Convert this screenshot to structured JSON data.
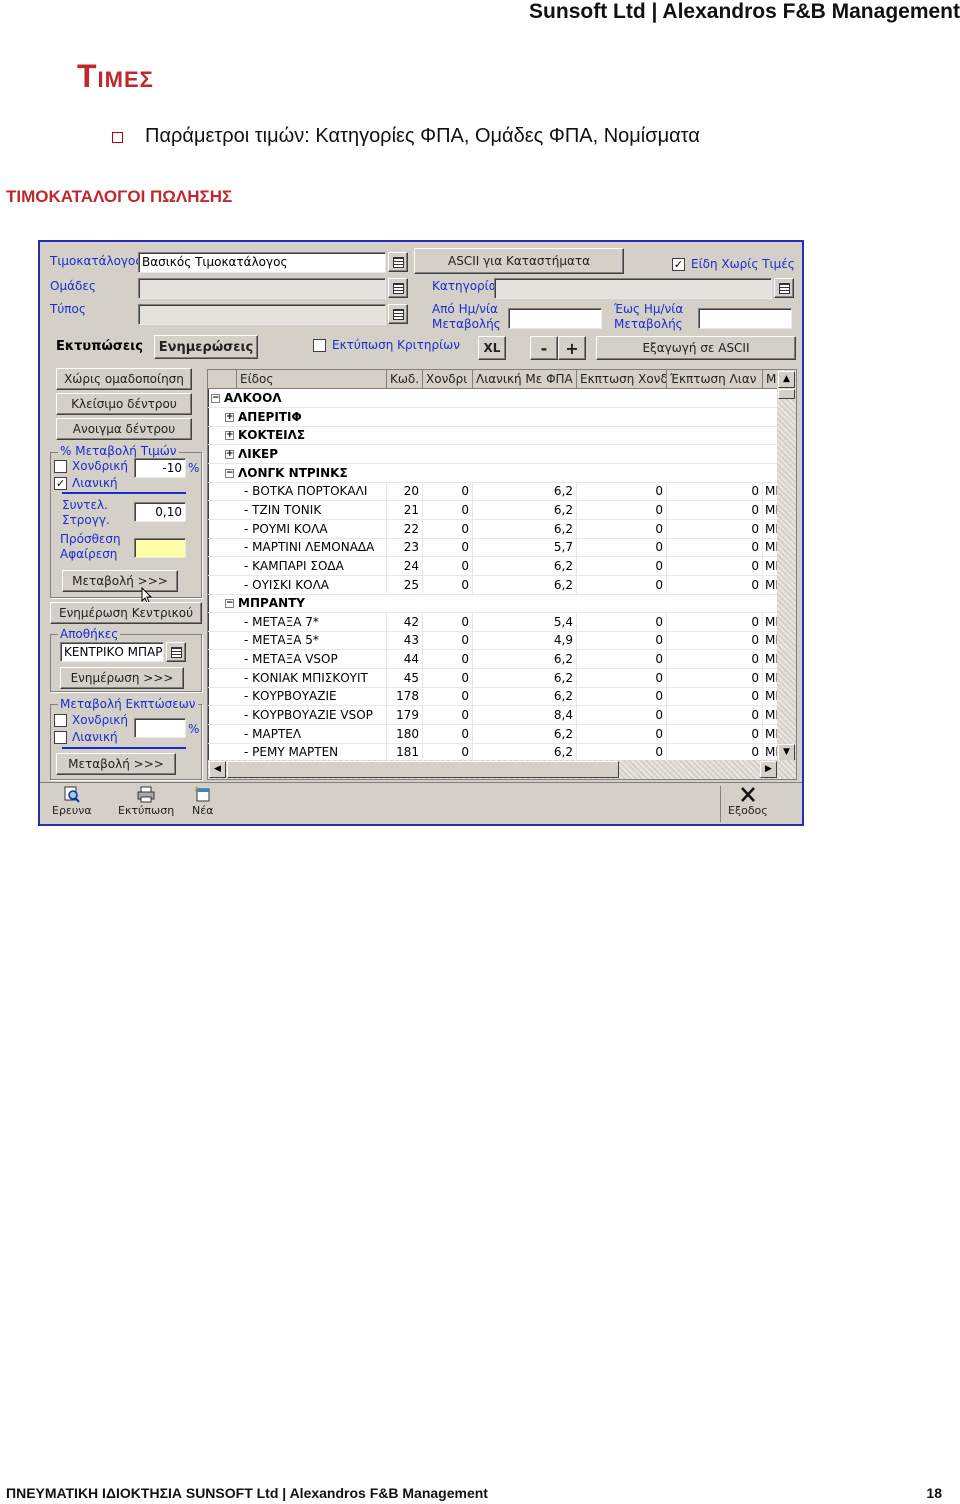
{
  "header": "Sunsoft Ltd  |  Alexandros F&B Management",
  "title": "Τιμες",
  "bullet": "Παράμετροι τιμών: Κατηγορίες ΦΠΑ, Ομάδες ΦΠΑ, Νομίσματα",
  "subheading": "ΤΙΜΟΚΑΤΑΛΟΓΟΙ ΠΩΛΗΣΗΣ",
  "app": {
    "pricelist_label": "Τιμοκατάλογος",
    "pricelist_value": "Βασικός Τιμοκατάλογος",
    "groups_label": "Ομάδες",
    "type_label": "Τύπος",
    "ascii_button": "ASCII για Καταστήματα",
    "no_price_items_label": "Είδη Χωρίς Τιμές",
    "category_label": "Κατηγορία",
    "from_date_label": "Από Ημ/νία Μεταβολής",
    "to_date_label": "Έως Ημ/νία Μεταβολής",
    "tab_prints": "Εκτυπώσεις",
    "tab_updates": "Ενημερώσεις",
    "print_criteria_label": "Εκτύπωση Κριτηρίων",
    "xl_button": "XL",
    "minus_button": "-",
    "plus_button": "+",
    "export_ascii_button": "Εξαγωγή σε ASCII",
    "side": {
      "no_grouping": "Χώρις ομαδοποίηση",
      "close_tree": "Κλείσιμο δέντρου",
      "open_tree": "Ανοιγμα δέντρου",
      "price_change_group": "% Μεταβολή Τιμών",
      "wholesale": "Χονδρική",
      "retail": "Λιανική",
      "percent_value": "-10",
      "percent_sign": "%",
      "rounding_label": "Συντελ. Στρογγ.",
      "rounding_value": "0,10",
      "add_remove_label": "Πρόσθεση Αφαίρεση",
      "change_button": "Μεταβολή >>>",
      "update_central": "Ενημέρωση Κεντρικού",
      "stores_group": "Αποθήκες",
      "store_value": "ΚΕΝΤΡΙΚΟ ΜΠΑΡ",
      "update_button": "Ενημέρωση >>>",
      "discount_change_group": "Μεταβολή Εκπτώσεων",
      "wholesale2": "Χονδρική",
      "retail2": "Λιανική",
      "percent_sign2": "%",
      "change_button2": "Μεταβολή >>>"
    },
    "grid": {
      "columns": [
        "Είδος",
        "Κωδ.",
        "Χονδρι",
        "Λιανική Με ΦΠΑ",
        "Εκπτωση Χονδ",
        "Έκπτωση Λιαν",
        "Μο"
      ],
      "rows": [
        {
          "kind": "group",
          "toggle": "−",
          "indent": 0,
          "name": "ΑΛΚΟΟΛ"
        },
        {
          "kind": "group",
          "toggle": "+",
          "indent": 1,
          "name": "ΑΠΕΡΙΤΙΦ"
        },
        {
          "kind": "group",
          "toggle": "+",
          "indent": 1,
          "name": "ΚΟΚΤΕΙΛΣ"
        },
        {
          "kind": "group",
          "toggle": "+",
          "indent": 1,
          "name": "ΛΙΚΕΡ"
        },
        {
          "kind": "group",
          "toggle": "−",
          "indent": 1,
          "name": "ΛΟΝΓΚ ΝΤΡΙΝΚΣ"
        },
        {
          "kind": "item",
          "name": "- ΒΟΤΚΑ ΠΟΡΤΟΚΑΛΙ",
          "code": "20",
          "wh": "0",
          "ret": "6,2",
          "dw": "0",
          "dr": "0",
          "m": "ΜΕ"
        },
        {
          "kind": "item",
          "name": "- ΤΖΙΝ ΤΟΝΙΚ",
          "code": "21",
          "wh": "0",
          "ret": "6,2",
          "dw": "0",
          "dr": "0",
          "m": "ΜΕ"
        },
        {
          "kind": "item",
          "name": "- ΡΟΥΜΙ ΚΟΛΑ",
          "code": "22",
          "wh": "0",
          "ret": "6,2",
          "dw": "0",
          "dr": "0",
          "m": "ΜΕ"
        },
        {
          "kind": "item",
          "name": "- ΜΑΡΤΙΝΙ ΛΕΜΟΝΑΔΑ",
          "code": "23",
          "wh": "0",
          "ret": "5,7",
          "dw": "0",
          "dr": "0",
          "m": "ΜΕ"
        },
        {
          "kind": "item",
          "name": "- ΚΑΜΠΑΡΙ ΣΟΔΑ",
          "code": "24",
          "wh": "0",
          "ret": "6,2",
          "dw": "0",
          "dr": "0",
          "m": "ΜΕ"
        },
        {
          "kind": "item",
          "name": "- ΟΥΙΣΚΙ ΚΟΛΑ",
          "code": "25",
          "wh": "0",
          "ret": "6,2",
          "dw": "0",
          "dr": "0",
          "m": "ΜΕ"
        },
        {
          "kind": "group",
          "toggle": "−",
          "indent": 1,
          "name": "ΜΠΡΑΝΤΥ"
        },
        {
          "kind": "item",
          "name": "- ΜΕΤΑΞΑ 7*",
          "code": "42",
          "wh": "0",
          "ret": "5,4",
          "dw": "0",
          "dr": "0",
          "m": "ΜΕ"
        },
        {
          "kind": "item",
          "name": "- ΜΕΤΑΞΑ 5*",
          "code": "43",
          "wh": "0",
          "ret": "4,9",
          "dw": "0",
          "dr": "0",
          "m": "ΜΕ"
        },
        {
          "kind": "item",
          "name": "- ΜΕΤΑΞΑ VSOP",
          "code": "44",
          "wh": "0",
          "ret": "6,2",
          "dw": "0",
          "dr": "0",
          "m": "ΜΕ"
        },
        {
          "kind": "item",
          "name": "- ΚΟΝΙΑΚ ΜΠΙΣΚΟΥΙΤ",
          "code": "45",
          "wh": "0",
          "ret": "6,2",
          "dw": "0",
          "dr": "0",
          "m": "ΜΕ"
        },
        {
          "kind": "item",
          "name": "- ΚΟΥΡΒΟΥΑΖΙΕ",
          "code": "178",
          "wh": "0",
          "ret": "6,2",
          "dw": "0",
          "dr": "0",
          "m": "ΜΕ"
        },
        {
          "kind": "item",
          "name": "- ΚΟΥΡΒΟΥΑΖΙΕ  VSOP",
          "code": "179",
          "wh": "0",
          "ret": "8,4",
          "dw": "0",
          "dr": "0",
          "m": "ΜΕ"
        },
        {
          "kind": "item",
          "name": "- ΜΑΡΤΕΛ",
          "code": "180",
          "wh": "0",
          "ret": "6,2",
          "dw": "0",
          "dr": "0",
          "m": "ΜΕ"
        },
        {
          "kind": "item",
          "name": "- ΡΕΜΥ ΜΑΡΤΕΝ",
          "code": "181",
          "wh": "0",
          "ret": "6,2",
          "dw": "0",
          "dr": "0",
          "m": "ΜΕ"
        }
      ]
    },
    "toolbar": {
      "search": "Ερευνα",
      "print": "Εκτύπωση",
      "new": "Νέα",
      "exit": "Εξοδος"
    }
  },
  "footer": "ΠΝΕΥΜΑΤΙΚΗ ΙΔΙΟΚΤΗΣΙΑ  SUNSOFT  Ltd   |   Alexandros F&B Management",
  "page_number": "18"
}
